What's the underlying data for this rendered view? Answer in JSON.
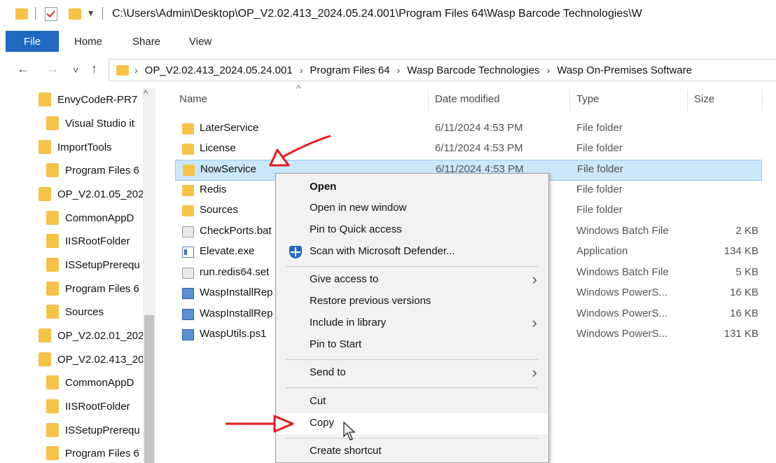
{
  "titlebar": {
    "path": "C:\\Users\\Admin\\Desktop\\OP_V2.02.413_2024.05.24.001\\Program Files 64\\Wasp Barcode Technologies\\W",
    "qa_dropdown": "▾"
  },
  "ribbon": {
    "tabs": [
      "File",
      "Home",
      "Share",
      "View"
    ]
  },
  "nav": {
    "back": "←",
    "forward": "→",
    "recent": "˅",
    "up": "↑"
  },
  "address": {
    "crumbs": [
      "OP_V2.02.413_2024.05.24.001",
      "Program Files 64",
      "Wasp Barcode Technologies",
      "Wasp On-Premises Software"
    ],
    "separator": "›",
    "lead_separator": "›"
  },
  "sidebar": {
    "items": [
      {
        "label": "EnvyCodeR-PR7",
        "level": 0
      },
      {
        "label": "Visual Studio it",
        "level": 1
      },
      {
        "label": "ImportTools",
        "level": 0
      },
      {
        "label": "Program Files 6",
        "level": 1
      },
      {
        "label": "OP_V2.01.05_202",
        "level": 0
      },
      {
        "label": "CommonAppD",
        "level": 1
      },
      {
        "label": "IISRootFolder",
        "level": 1
      },
      {
        "label": "ISSetupPrerequ",
        "level": 1
      },
      {
        "label": "Program Files 6",
        "level": 1
      },
      {
        "label": "Sources",
        "level": 1
      },
      {
        "label": "OP_V2.02.01_202",
        "level": 0
      },
      {
        "label": "OP_V2.02.413_20",
        "level": 0
      },
      {
        "label": "CommonAppD",
        "level": 1
      },
      {
        "label": "IISRootFolder",
        "level": 1
      },
      {
        "label": "ISSetupPrerequ",
        "level": 1
      },
      {
        "label": "Program Files 6",
        "level": 1
      }
    ],
    "scroll_up": "^"
  },
  "columns": {
    "name": "Name",
    "date": "Date modified",
    "type": "Type",
    "size": "Size",
    "sort_indicator": "^"
  },
  "files": [
    {
      "name": "LaterService",
      "date": "6/11/2024 4:53 PM",
      "type": "File folder",
      "size": "",
      "icon": "folder-icon",
      "selected": false
    },
    {
      "name": "License",
      "date": "6/11/2024 4:53 PM",
      "type": "File folder",
      "size": "",
      "icon": "folder-icon",
      "selected": false
    },
    {
      "name": "NowService",
      "date": "6/11/2024 4:53 PM",
      "type": "File folder",
      "size": "",
      "icon": "folder-icon",
      "selected": true
    },
    {
      "name": "Redis",
      "date": "",
      "type": "File folder",
      "size": "",
      "icon": "folder-icon",
      "selected": false
    },
    {
      "name": "Sources",
      "date": "",
      "type": "File folder",
      "size": "",
      "icon": "folder-icon",
      "selected": false
    },
    {
      "name": "CheckPorts.bat",
      "date": "",
      "type": "Windows Batch File",
      "size": "2 KB",
      "icon": "batch-file-icon",
      "selected": false
    },
    {
      "name": "Elevate.exe",
      "date": "",
      "type": "Application",
      "size": "134 KB",
      "icon": "application-icon",
      "selected": false
    },
    {
      "name": "run.redis64.set",
      "date": "",
      "type": "Windows Batch File",
      "size": "5 KB",
      "icon": "batch-file-icon",
      "selected": false
    },
    {
      "name": "WaspInstallRep",
      "date": "",
      "type": "Windows PowerS...",
      "size": "16 KB",
      "icon": "powershell-file-icon",
      "selected": false
    },
    {
      "name": "WaspInstallRep",
      "date": "",
      "type": "Windows PowerS...",
      "size": "16 KB",
      "icon": "powershell-file-icon",
      "selected": false
    },
    {
      "name": "WaspUtils.ps1",
      "date": "",
      "type": "Windows PowerS...",
      "size": "131 KB",
      "icon": "powershell-file-icon",
      "selected": false
    }
  ],
  "context_menu": {
    "items": [
      {
        "label": "Open",
        "bold": true,
        "submenu": false
      },
      {
        "label": "Open in new window",
        "submenu": false
      },
      {
        "label": "Pin to Quick access",
        "submenu": false
      },
      {
        "label": "Scan with Microsoft Defender...",
        "submenu": false,
        "icon": "defender-shield-icon"
      },
      {
        "separator": true
      },
      {
        "label": "Give access to",
        "submenu": true
      },
      {
        "label": "Restore previous versions",
        "submenu": false
      },
      {
        "label": "Include in library",
        "submenu": true
      },
      {
        "label": "Pin to Start",
        "submenu": false
      },
      {
        "separator": true
      },
      {
        "label": "Send to",
        "submenu": true
      },
      {
        "separator": true
      },
      {
        "label": "Cut",
        "submenu": false
      },
      {
        "label": "Copy",
        "submenu": false,
        "highlighted": true
      },
      {
        "separator": true
      },
      {
        "label": "Create shortcut",
        "submenu": false
      }
    ],
    "submenu_glyph": "›"
  },
  "colors": {
    "file_tab": "#1f69c2",
    "selection": "#cce6fa",
    "folder": "#f5c34a",
    "annotation_arrow": "#e01b1b"
  }
}
